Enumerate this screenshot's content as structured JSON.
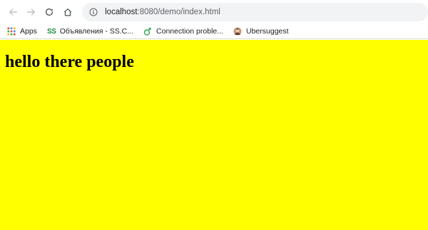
{
  "toolbar": {
    "back_icon": "arrow-left-icon",
    "forward_icon": "arrow-right-icon",
    "reload_icon": "reload-icon",
    "home_icon": "home-icon",
    "address": {
      "host": "localhost",
      "path": ":8080/demo/index.html"
    }
  },
  "bookmarks": [
    {
      "label": "Apps",
      "icon": "apps-grid-icon"
    },
    {
      "label": "Объявления - SS.C...",
      "icon": "ss-logo-icon",
      "icon_text": "SS"
    },
    {
      "label": "Connection proble...",
      "icon": "connection-icon"
    },
    {
      "label": "Ubersuggest",
      "icon": "ubersuggest-avatar-icon"
    }
  ],
  "page": {
    "background": "#ffff00",
    "heading": "hello there people"
  }
}
